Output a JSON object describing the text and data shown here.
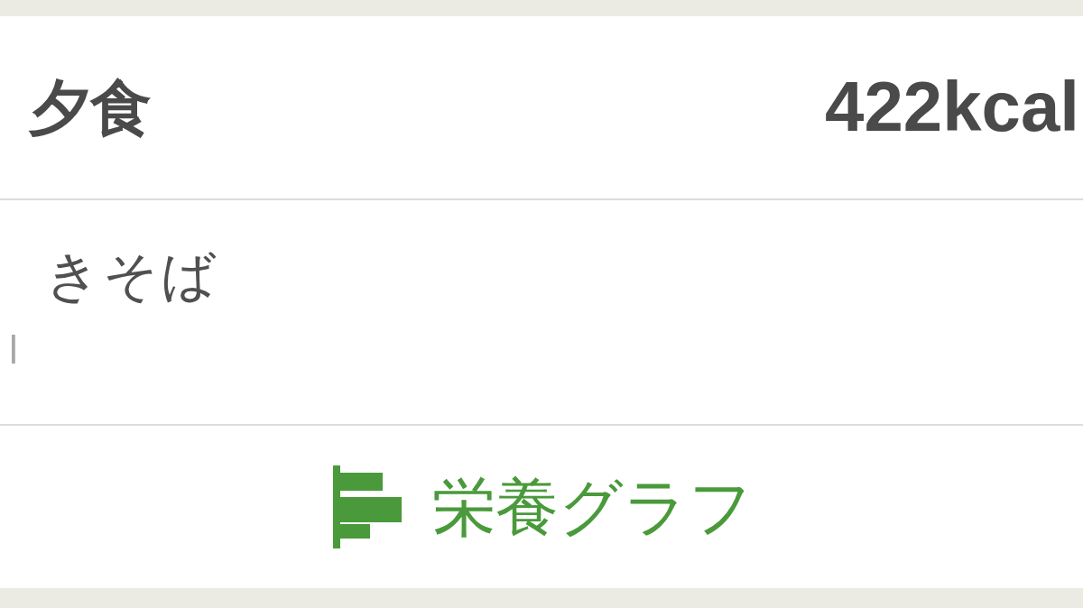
{
  "meal": {
    "title": "夕食",
    "calories": "422kcal"
  },
  "foods": [
    {
      "name": "きそば",
      "calories": "l"
    }
  ],
  "nutrition_graph_link": {
    "label": "栄養グラフ"
  }
}
